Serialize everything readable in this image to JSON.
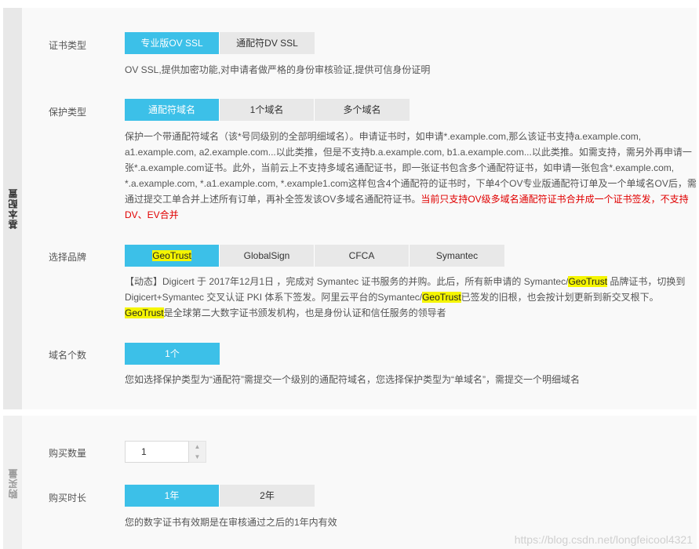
{
  "basic": {
    "side_label": "基本配置",
    "cert_type": {
      "label": "证书类型",
      "options": [
        "专业版OV SSL",
        "通配符DV SSL"
      ],
      "selected": 0,
      "desc": "OV SSL,提供加密功能,对申请者做严格的身份审核验证,提供可信身份证明"
    },
    "protect_type": {
      "label": "保护类型",
      "options": [
        "通配符域名",
        "1个域名",
        "多个域名"
      ],
      "selected": 0,
      "desc_lines": [
        "保护一个带通配符域名（该*号同级别的全部明细域名）。申请证书时，如申请*.example.com,那么该证书支持a.example.com,",
        "a1.example.com, a2.example.com...以此类推，但是不支持b.a.example.com, b1.a.example.com...以此类推。如需支持，需另外再申请一",
        "张*.a.example.com证书。此外，当前云上不支持多域名通配证书，即一张证书包含多个通配符证书，如申请一张包含*.example.com,",
        "*.a.example.com, *.a1.example.com, *.example1.com这样包含4个通配符的证书时，下单4个OV专业版通配符订单及一个单域名OV后，需",
        "通过提交工单合并上述所有订单，再补全签发该OV多域名通配符证书。"
      ],
      "desc_red_1": "当前只支持OV级多域名通配符证书合并成一个证书签发，不支持",
      "desc_red_2": "DV、EV合并"
    },
    "brand": {
      "label": "选择品牌",
      "options": [
        "GeoTrust",
        "GlobalSign",
        "CFCA",
        "Symantec"
      ],
      "selected": 0,
      "desc_l1_a": "【动态】Digicert 于 2017年12月1日 ，完成对 Symantec 证书服务的并购。此后，所有新申请的 Symantec/",
      "desc_l1_hl": "GeoTrust",
      "desc_l1_b": " 品牌证书，切换到",
      "desc_l2_a": "Digicert+Symantec 交叉认证 PKI 体系下签发。阿里云平台的Symantec/",
      "desc_l2_hl": "GeoTrust",
      "desc_l2_b": "已签发的旧根，也会按计划更新到新交叉根下。",
      "desc_l3_hl": "GeoTrust",
      "desc_l3_b": "是全球第二大数字证书颁发机构，也是身份认证和信任服务的领导者"
    },
    "domain_count": {
      "label": "域名个数",
      "options": [
        "1个"
      ],
      "selected": 0,
      "desc": "您如选择保护类型为“通配符”需提交一个级别的通配符域名，您选择保护类型为“单域名”，需提交一个明细域名"
    }
  },
  "purchase": {
    "side_label": "购买量",
    "quantity": {
      "label": "购买数量",
      "value": "1"
    },
    "duration": {
      "label": "购买时长",
      "options": [
        "1年",
        "2年"
      ],
      "selected": 0,
      "desc": "您的数字证书有效期是在审核通过之后的1年内有效"
    }
  },
  "watermark": "https://blog.csdn.net/longfeicool4321",
  "colors": {
    "accent": "#3cc0e8",
    "highlight": "#f5f500",
    "warning": "#e00000"
  }
}
